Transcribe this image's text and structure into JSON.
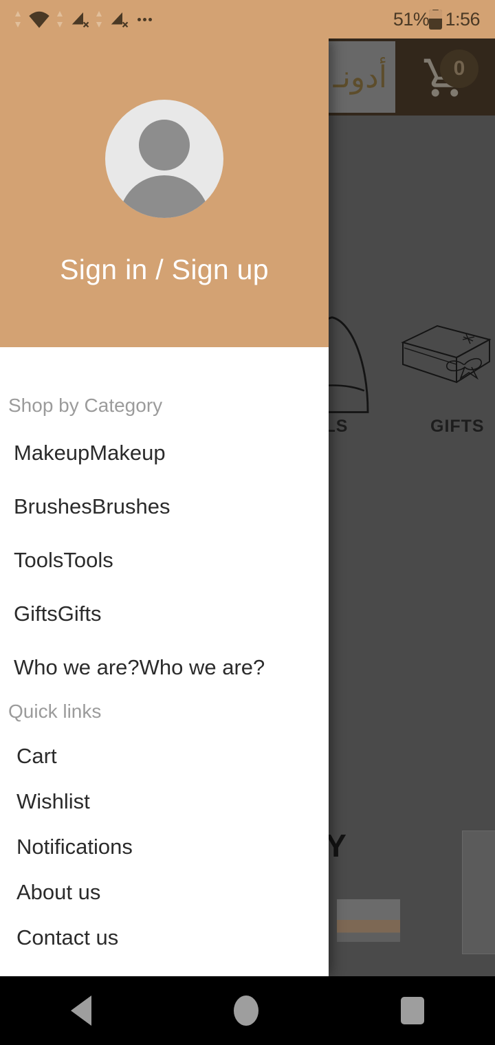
{
  "status_bar": {
    "wifi_icon": "wifi-icon",
    "signal_icons": [
      "signal-no-sim-icon",
      "signal-no-sim-icon"
    ],
    "more_icon": "more-icons-ellipsis",
    "battery_percent": "51%",
    "battery_icon": "battery-icon",
    "time": "1:56"
  },
  "drawer": {
    "avatar_icon": "user-avatar-icon",
    "sign_in_label": "Sign in / Sign up",
    "categories_header": "Shop by Category",
    "category_items": [
      {
        "label": "MakeupMakeup"
      },
      {
        "label": "BrushesBrushes"
      },
      {
        "label": "ToolsTools"
      },
      {
        "label": "GiftsGifts"
      },
      {
        "label": "Who we are?Who we are?"
      }
    ],
    "quick_links_header": "Quick links",
    "quick_link_items": [
      {
        "label": "Cart"
      },
      {
        "label": "Wishlist"
      },
      {
        "label": "Notifications"
      },
      {
        "label": "About us"
      },
      {
        "label": "Contact us"
      }
    ]
  },
  "background_app": {
    "logo_text": "أدونـ",
    "cart_icon": "shopping-cart-icon",
    "cart_badge_count": "0",
    "search_placeholder": "؟",
    "mic_icon": "microphone-icon",
    "categories": [
      {
        "label": "OLS",
        "icon": "tools-icon"
      },
      {
        "label": "GIFTS",
        "icon": "gift-box-icon"
      }
    ],
    "brand_arabic": "أدونـي",
    "section_text": "NY"
  },
  "nav_bar": {
    "back_icon": "back-triangle-icon",
    "home_icon": "home-circle-icon",
    "recents_icon": "recents-square-icon"
  },
  "colors": {
    "drawer_header": "#d3a273",
    "status_bar": "#d3a273",
    "app_bar": "#4a3a28",
    "brand_gold": "#8a7240",
    "drawer_bg": "#ffffff"
  }
}
